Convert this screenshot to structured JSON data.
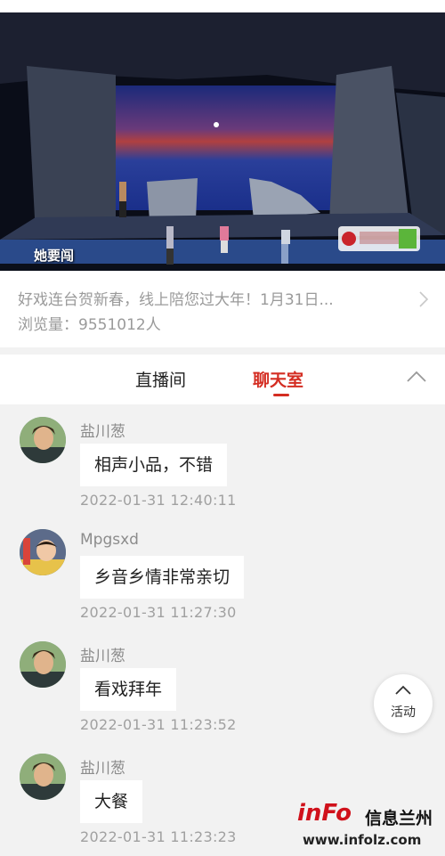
{
  "video": {
    "caption": "她要闯"
  },
  "info": {
    "title": "好戏连台贺新春，线上陪您过大年！1月31日...",
    "views": "浏览量：9551012人"
  },
  "tabs": [
    {
      "label": "直播间",
      "active": false
    },
    {
      "label": "聊天室",
      "active": true
    }
  ],
  "messages": [
    {
      "user": "盐川葱",
      "text": "相声小品，不错",
      "time": "2022-01-31  12:40:11",
      "avatar": "man-avatar"
    },
    {
      "user": "Mpgsxd",
      "text": "乡音乡情非常亲切",
      "time": "2022-01-31  11:27:30",
      "avatar": "child-avatar"
    },
    {
      "user": "盐川葱",
      "text": "看戏拜年",
      "time": "2022-01-31  11:23:52",
      "avatar": "man-avatar"
    },
    {
      "user": "盐川葱",
      "text": "大餐",
      "time": "2022-01-31  11:23:23",
      "avatar": "man-avatar"
    }
  ],
  "fab": {
    "label": "活动"
  },
  "watermark": {
    "brand": "inFo",
    "chinese": "信息兰州",
    "url": "www.infolz.com"
  },
  "colors": {
    "accent": "#d42d22",
    "background": "#f2f2f2"
  }
}
